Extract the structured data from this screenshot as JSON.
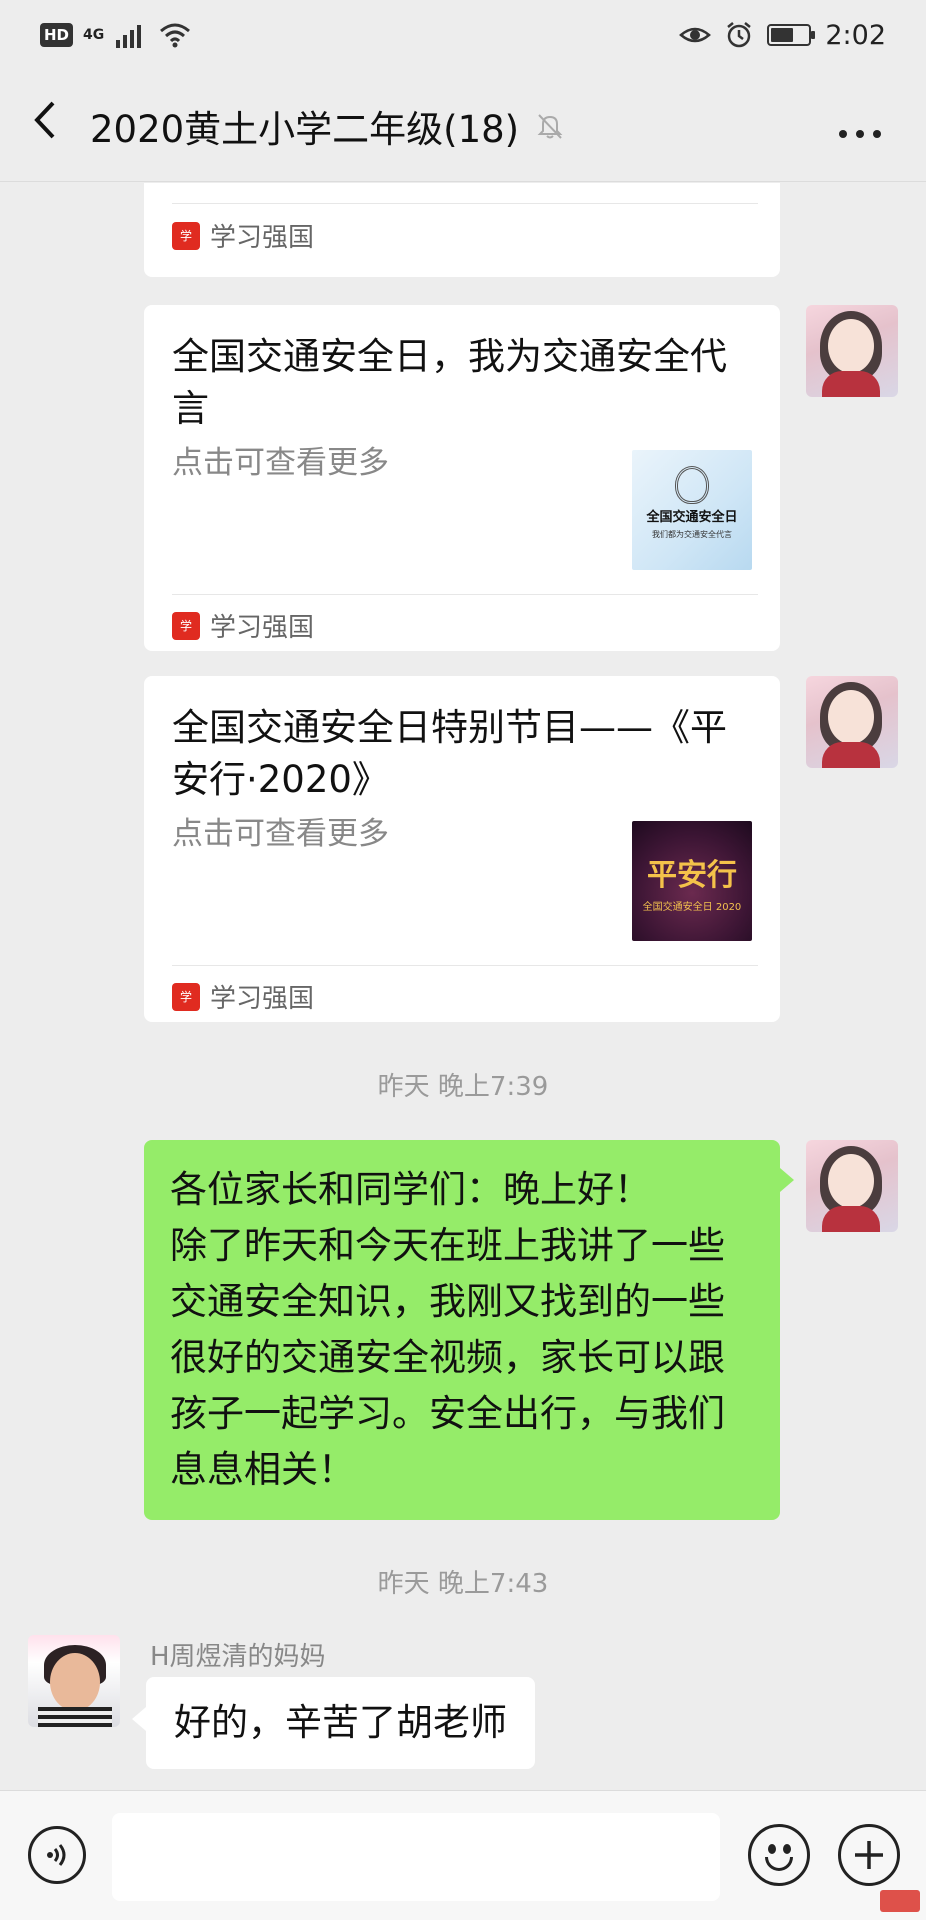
{
  "status_bar": {
    "hd": "HD",
    "network": "4G",
    "time": "2:02",
    "battery_level": 0.6,
    "icons": [
      "signal-icon",
      "wifi-icon",
      "eye-icon",
      "alarm-icon",
      "battery-icon"
    ]
  },
  "header": {
    "back_icon": "back-arrow-icon",
    "title": "2020黄土小学二年级(18)",
    "mute_icon": "bell-muted-icon",
    "more_icon": "more-dots-icon"
  },
  "messages": [
    {
      "type": "card",
      "source": "学习强国"
    },
    {
      "type": "card",
      "title": "全国交通安全日，我为交通安全代言",
      "desc": "点击可查看更多",
      "thumb_title": "全国交通安全日",
      "thumb_sub": "我们都为交通安全代言",
      "source": "学习强国"
    },
    {
      "type": "card",
      "title": "全国交通安全日特别节目——《平安行·2020》",
      "desc": "点击可查看更多",
      "thumb_title": "平安行",
      "thumb_sub": "全国交通安全日 2020",
      "source": "学习强国"
    },
    {
      "type": "time",
      "text": "昨天 晚上7:39"
    },
    {
      "type": "text",
      "lines": [
        "各位家长和同学们：晚上好！",
        "除了昨天和今天在班上我讲了一些",
        "交通安全知识，我刚又找到的一些",
        "很好的交通安全视频，家长可以跟",
        "孩子一起学习。安全出行，与我们",
        "息息相关！"
      ]
    },
    {
      "type": "time",
      "text": "昨天 晚上7:43"
    },
    {
      "type": "text",
      "sender": "H周煜清的妈妈",
      "text": "好的，辛苦了胡老师"
    }
  ],
  "input_bar": {
    "placeholder": "",
    "icons": [
      "voice-icon",
      "emoji-icon",
      "plus-icon"
    ]
  },
  "colors": {
    "background": "#ededed",
    "my_bubble": "#95ec69",
    "card": "#ffffff",
    "source_logo": "#e02b20"
  }
}
